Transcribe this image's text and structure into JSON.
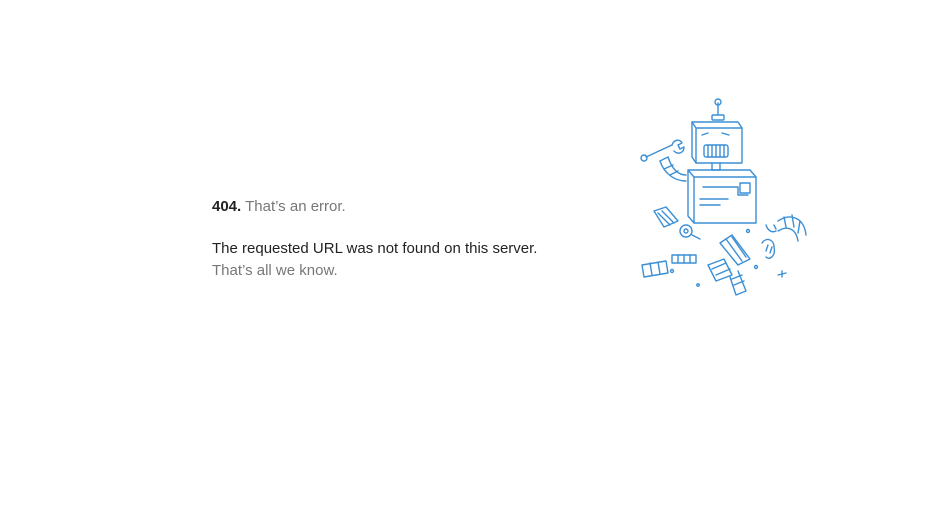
{
  "error": {
    "code": "404.",
    "title": "That’s an error.",
    "message_prefix": "The requested URL",
    "message_suffix": "was not found on this server.",
    "footer": "That’s all we know."
  },
  "illustration": {
    "icon": "broken-robot-icon",
    "stroke_color": "#3b8fd6"
  }
}
